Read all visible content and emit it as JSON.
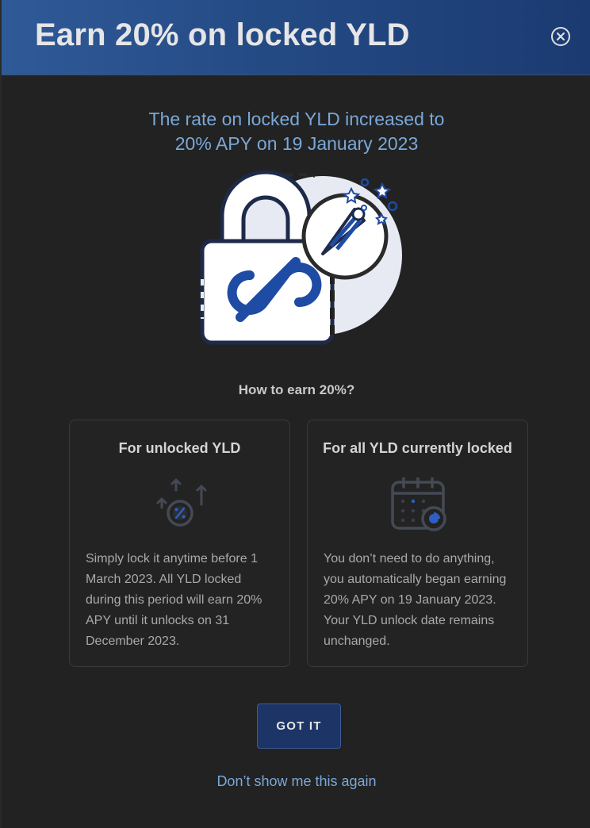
{
  "header": {
    "title": "Earn 20% on locked YLD",
    "close_icon": "close-circle-icon"
  },
  "headline": {
    "line1": "The rate on locked YLD increased to",
    "line2": "20% APY on 19 January 2023"
  },
  "hero_icon": "padlock-percent-party-icon",
  "how_to": "How to earn 20%?",
  "cards": [
    {
      "title": "For unlocked YLD",
      "icon": "percent-coin-arrows-icon",
      "text": "Simply lock it anytime before 1 March 2023. All YLD locked during this period will earn 20% APY until it unlocks on 31 December 2023."
    },
    {
      "title": "For all YLD currently locked",
      "icon": "calendar-clock-icon",
      "text": "You don’t need to do anything, you automatically began earning 20% APY on 19 January 2023. Your YLD unlock date remains unchanged."
    }
  ],
  "button_label": "GOT IT",
  "dont_show_label": "Don’t show me this again",
  "colors": {
    "header_gradient_start": "#2f5a98",
    "header_gradient_end": "#1b3a72",
    "accent_text": "#7aa8d8",
    "button_bg": "#1d3566",
    "background": "#222222"
  }
}
